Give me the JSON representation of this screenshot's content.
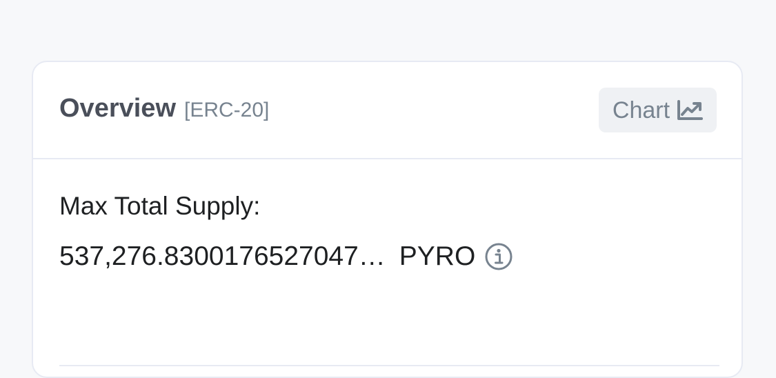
{
  "overview": {
    "title": "Overview",
    "subtitle": "[ERC-20]",
    "chart_button_label": "Chart",
    "chart_icon": "chart-line-icon"
  },
  "supply": {
    "label": "Max Total Supply:",
    "value": "537,276.8300176527047…",
    "symbol": "PYRO",
    "info_icon": "info-icon"
  },
  "colors": {
    "background": "#f7f8fa",
    "card": "#ffffff",
    "border": "#e7eaf3",
    "title": "#4a4f5a",
    "muted": "#77838f",
    "text": "#1e2022",
    "button_bg": "#eff1f4"
  }
}
